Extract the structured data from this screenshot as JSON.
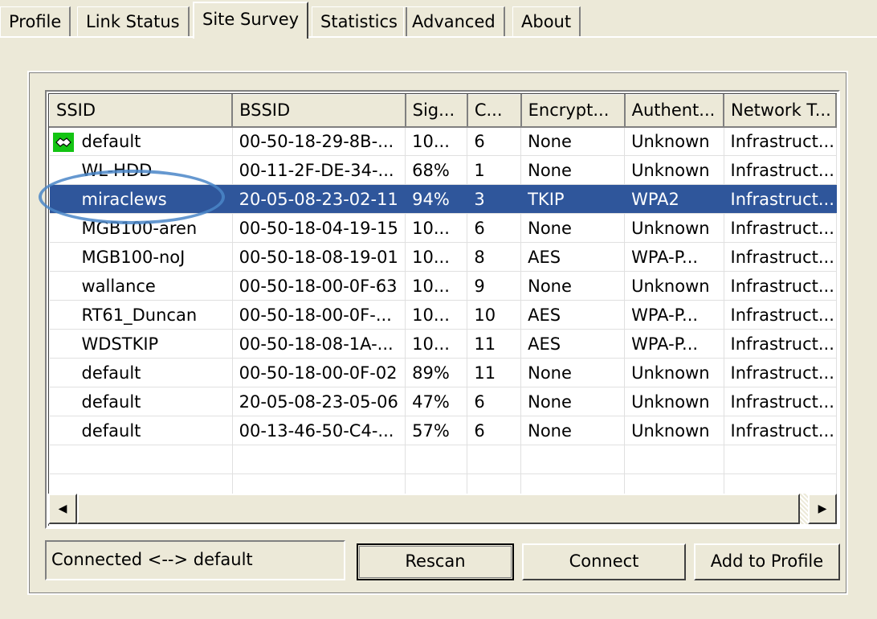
{
  "tabs": [
    {
      "label": "Profile"
    },
    {
      "label": "Link Status"
    },
    {
      "label": "Site Survey"
    },
    {
      "label": "Statistics"
    },
    {
      "label": "Advanced"
    },
    {
      "label": "About"
    }
  ],
  "active_tab": "Site Survey",
  "table": {
    "columns": [
      "SSID",
      "BSSID",
      "Sig...",
      "C...",
      "Encrypt...",
      "Authent...",
      "Network T..."
    ],
    "rows": [
      {
        "ssid": "default",
        "bssid": "00-50-18-29-8B-...",
        "signal": "10...",
        "channel": "6",
        "encrypt": "None",
        "auth": "Unknown",
        "network": "Infrastruct...",
        "icon": "connected-handshake-icon"
      },
      {
        "ssid": "WL-HDD",
        "bssid": "00-11-2F-DE-34-...",
        "signal": "68%",
        "channel": "1",
        "encrypt": "None",
        "auth": "Unknown",
        "network": "Infrastruct..."
      },
      {
        "ssid": "miraclews",
        "bssid": "20-05-08-23-02-11",
        "signal": "94%",
        "channel": "3",
        "encrypt": "TKIP",
        "auth": "WPA2",
        "network": "Infrastruct...",
        "selected": true
      },
      {
        "ssid": "MGB100-aren",
        "bssid": "00-50-18-04-19-15",
        "signal": "10...",
        "channel": "6",
        "encrypt": "None",
        "auth": "Unknown",
        "network": "Infrastruct..."
      },
      {
        "ssid": "MGB100-noJ",
        "bssid": "00-50-18-08-19-01",
        "signal": "10...",
        "channel": "8",
        "encrypt": "AES",
        "auth": "WPA-P...",
        "network": "Infrastruct..."
      },
      {
        "ssid": "wallance",
        "bssid": "00-50-18-00-0F-63",
        "signal": "10...",
        "channel": "9",
        "encrypt": "None",
        "auth": "Unknown",
        "network": "Infrastruct..."
      },
      {
        "ssid": "RT61_Duncan",
        "bssid": "00-50-18-00-0F-...",
        "signal": "10...",
        "channel": "10",
        "encrypt": "AES",
        "auth": "WPA-P...",
        "network": "Infrastruct..."
      },
      {
        "ssid": "WDSTKIP",
        "bssid": "00-50-18-08-1A-...",
        "signal": "10...",
        "channel": "11",
        "encrypt": "AES",
        "auth": "WPA-P...",
        "network": "Infrastruct..."
      },
      {
        "ssid": "default",
        "bssid": "00-50-18-00-0F-02",
        "signal": "89%",
        "channel": "11",
        "encrypt": "None",
        "auth": "Unknown",
        "network": "Infrastruct..."
      },
      {
        "ssid": "default",
        "bssid": "20-05-08-23-05-06",
        "signal": "47%",
        "channel": "6",
        "encrypt": "None",
        "auth": "Unknown",
        "network": "Infrastruct..."
      },
      {
        "ssid": "default",
        "bssid": "00-13-46-50-C4-...",
        "signal": "57%",
        "channel": "6",
        "encrypt": "None",
        "auth": "Unknown",
        "network": "Infrastruct..."
      }
    ]
  },
  "status": "Connected <--> default",
  "buttons": {
    "rescan": "Rescan",
    "connect": "Connect",
    "add_to_profile": "Add to Profile"
  },
  "colors": {
    "selection": "#2f569b",
    "annotation_oval": "#4a86c8",
    "icon_bg": "#13c413"
  }
}
